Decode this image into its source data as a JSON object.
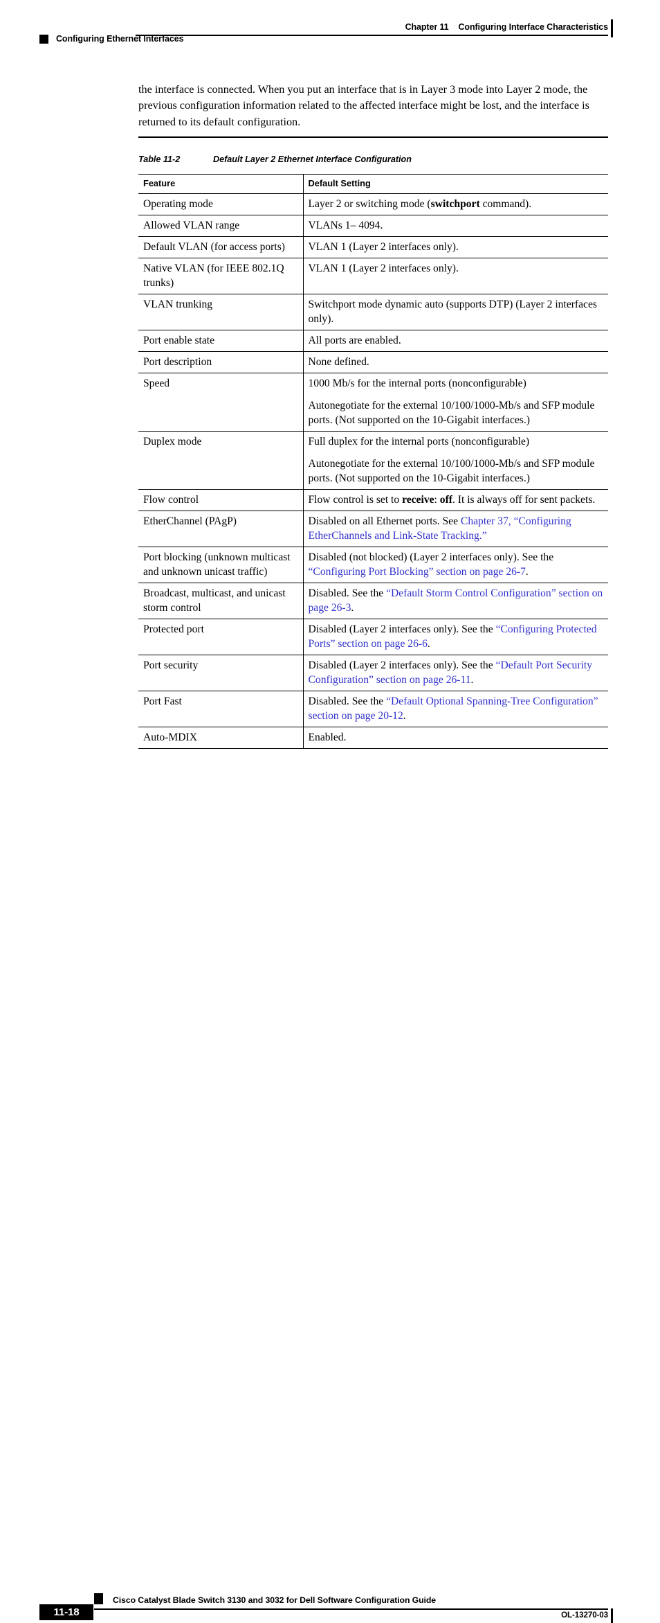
{
  "header": {
    "chapter_number": "Chapter 11",
    "chapter_title": "Configuring Interface Characteristics",
    "section_title": "Configuring Ethernet Interfaces"
  },
  "body": {
    "paragraph": "the interface is connected. When you put an interface that is in Layer 3 mode into Layer 2 mode, the previous configuration information related to the affected interface might be lost, and the interface is returned to its default configuration."
  },
  "table": {
    "caption_number": "Table 11-2",
    "caption_title": "Default Layer 2 Ethernet Interface Configuration",
    "columns": [
      "Feature",
      "Default Setting"
    ],
    "rows": [
      {
        "feature": "Operating mode",
        "setting_html": "Layer 2 or switching mode (<span class=\"bd\">switchport</span> command)."
      },
      {
        "feature": "Allowed VLAN range",
        "setting_html": "VLANs 1– 4094."
      },
      {
        "feature": "Default VLAN (for access ports)",
        "setting_html": "VLAN 1 (Layer 2 interfaces only)."
      },
      {
        "feature": "Native VLAN (for IEEE 802.1Q trunks)",
        "setting_html": "VLAN 1 (Layer 2 interfaces only)."
      },
      {
        "feature": "VLAN trunking",
        "setting_html": "Switchport mode dynamic auto (supports DTP) (Layer 2 interfaces only)."
      },
      {
        "feature": "Port enable state",
        "setting_html": "All ports are enabled."
      },
      {
        "feature": "Port description",
        "setting_html": "None defined."
      },
      {
        "feature": "Speed",
        "setting_html": "<p>1000 Mb/s for the internal ports (nonconfigurable)</p><p>Autonegotiate for the external 10/100/1000-Mb/s and SFP module ports. (Not supported on the 10-Gigabit interfaces.)</p>"
      },
      {
        "feature": "Duplex mode",
        "setting_html": "<p>Full duplex for the internal ports (nonconfigurable)</p><p>Autonegotiate for the external 10/100/1000-Mb/s and SFP module ports. (Not supported on the 10-Gigabit interfaces.)</p>"
      },
      {
        "feature": "Flow control",
        "setting_html": "Flow control is set to <span class=\"bd\">receive</span>: <span class=\"bd\">off</span>. It is always off for sent packets."
      },
      {
        "feature": "EtherChannel (PAgP)",
        "setting_html": "Disabled on all Ethernet ports. See <span class=\"lnk\">Chapter 37, “Configuring EtherChannels and Link-State Tracking.”</span>"
      },
      {
        "feature": "Port blocking (unknown multicast and unknown unicast traffic)",
        "setting_html": "Disabled (not blocked) (Layer 2 interfaces only). See the <span class=\"lnk\">“Configuring Port Blocking” section on page 26-7</span>."
      },
      {
        "feature": "Broadcast, multicast, and unicast storm control",
        "setting_html": "Disabled. See the <span class=\"lnk\">“Default Storm Control Configuration” section on page 26-3</span>."
      },
      {
        "feature": "Protected port",
        "setting_html": "Disabled (Layer 2 interfaces only). See the <span class=\"lnk\">“Configuring Protected Ports” section on page 26-6</span>."
      },
      {
        "feature": "Port security",
        "setting_html": "Disabled (Layer 2 interfaces only). See the <span class=\"lnk\">“Default Port Security Configuration” section on page 26-11</span>."
      },
      {
        "feature": "Port Fast",
        "setting_html": "Disabled. See the <span class=\"lnk\">“Default Optional Spanning-Tree Configuration” section on page 20-12</span>."
      },
      {
        "feature": "Auto-MDIX",
        "setting_html": "Enabled."
      }
    ]
  },
  "footer": {
    "document_title": "Cisco Catalyst Blade Switch 3130 and 3032 for Dell Software Configuration Guide",
    "page_number": "11-18",
    "document_id": "OL-13270-03"
  },
  "colors": {
    "link": "#3232cd",
    "text": "#000000",
    "background": "#ffffff"
  }
}
